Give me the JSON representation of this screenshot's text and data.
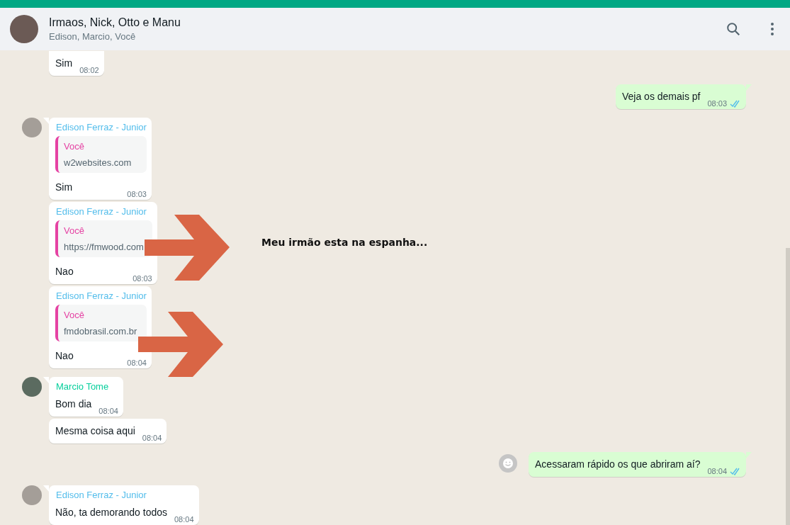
{
  "header": {
    "title": "Irmaos, Nick, Otto e Manu",
    "subtitle": "Edison, Marcio, Você"
  },
  "messages": [
    {
      "kind": "incoming",
      "first": false,
      "text": "Sim",
      "time": "08:02"
    },
    {
      "kind": "outgoing",
      "first": true,
      "text": "Veja os demais pf",
      "time": "08:03",
      "read": true,
      "emoji_button": false
    },
    {
      "kind": "incoming",
      "first": true,
      "sender": "Edison Ferraz - Junior",
      "color": "#53bdeb",
      "quote": {
        "author": "Você",
        "text": "w2websites.com"
      },
      "text": "Sim",
      "time": "08:03"
    },
    {
      "kind": "incoming",
      "first": false,
      "sender": "Edison Ferraz - Junior",
      "color": "#53bdeb",
      "quote": {
        "author": "Você",
        "text": "https://fmwood.com"
      },
      "text": "Nao",
      "time": "08:03"
    },
    {
      "kind": "incoming",
      "first": false,
      "sender": "Edison Ferraz - Junior",
      "color": "#53bdeb",
      "quote": {
        "author": "Você",
        "text": "fmdobrasil.com.br"
      },
      "text": "Nao",
      "time": "08:04"
    },
    {
      "kind": "incoming",
      "first": true,
      "sender": "Marcio Tome",
      "color": "#06cf9c",
      "text": "Bom dia",
      "time": "08:04"
    },
    {
      "kind": "incoming",
      "first": false,
      "text": "Mesma coisa aqui",
      "time": "08:04"
    },
    {
      "kind": "outgoing",
      "first": true,
      "text": "Acessaram rápido os que abriram aí?",
      "time": "08:04",
      "read": true,
      "emoji_button": true
    },
    {
      "kind": "incoming",
      "first": true,
      "sender": "Edison Ferraz - Junior",
      "color": "#53bdeb",
      "text": "Não, ta demorando todos",
      "time": "08:04"
    }
  ],
  "annotation": "Meu irmão esta na espanha..."
}
